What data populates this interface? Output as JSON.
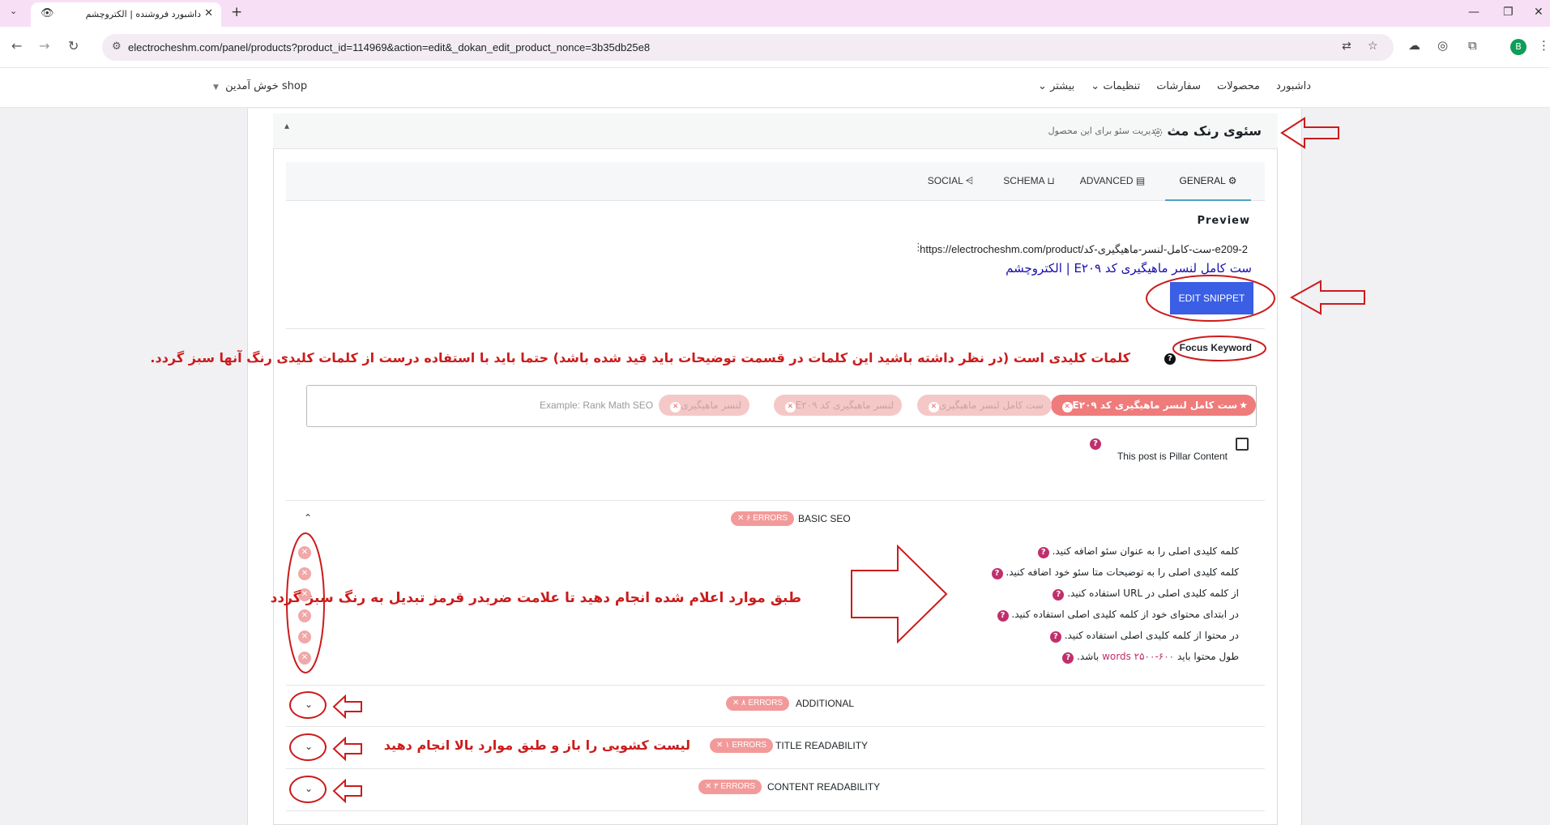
{
  "browser": {
    "tab_title": "داشبورد فروشنده | الکتروچشم",
    "url": "electrocheshm.com/panel/products?product_id=114969&action=edit&_dokan_edit_product_nonce=3b35db25e8",
    "profile_initial": "B"
  },
  "header": {
    "shop_menu": "shop خوش آمدین",
    "nav": [
      "داشبورد",
      "محصولات",
      "سفارشات",
      "تنظیمات",
      "بیشتر"
    ]
  },
  "panel": {
    "title": "سئوی رنک مث",
    "subtitle": "مدیریت سئو برای این محصول"
  },
  "tabs": [
    "GENERAL",
    "ADVANCED",
    "SCHEMA",
    "SOCIAL"
  ],
  "preview": {
    "label": "Preview",
    "url": "https://electrocheshm.com/product/ست-کامل-لنسر-ماهیگیری-کد-e209-2",
    "title": "ست کامل لنسر ماهیگیری کد E۲۰۹ | الکتروچشم",
    "edit_button": "EDIT SNIPPET"
  },
  "focus": {
    "label": "Focus Keyword",
    "note": "کلمات کلیدی است (در نظر داشته باشید این کلمات در قسمت توضیحات باید قید شده باشد) حتما باید با استفاده درست از کلمات کلیدی رنگ آنها سبز گردد.",
    "keywords": [
      "ست کامل لنسر ماهیگیری کد E۲۰۹",
      "ست کامل لنسر ماهیگیری",
      "لنسر ماهیگیری کد E۲۰۹",
      "لنسر ماهیگیری"
    ],
    "placeholder": "Example: Rank Math SEO",
    "pillar_label": "This post is Pillar Content"
  },
  "basic_seo": {
    "title": "BASIC SEO",
    "errors": "۶ ERRORS",
    "note": "طبق موارد اعلام شده انجام دهید تا علامت ضربدر قرمز تبدیل به رنگ سبز گردد",
    "items": [
      "کلمه کلیدی اصلی را به عنوان سئو اضافه کنید.",
      "کلمه کلیدی اصلی را به توضیحات متا سئو خود اضافه کنید.",
      "از کلمه کلیدی اصلی در URL استفاده کنید.",
      "در ابتدای محتوای خود از کلمه کلیدی اصلی استفاده کنید.",
      "در محتوا از کلمه کلیدی اصلی استفاده کنید."
    ],
    "last_item_prefix": "طول محتوا باید",
    "last_item_link": "words ۲۵۰۰-۶۰۰",
    "last_item_suffix": "باشد."
  },
  "additional": {
    "title": "ADDITIONAL",
    "errors": "۸ ERRORS"
  },
  "title_readability": {
    "title": "TITLE READABILITY",
    "errors": "۱ ERRORS",
    "note": "لیست کشویی را  باز و طبق موارد بالا انجام دهید"
  },
  "content_readability": {
    "title": "CONTENT READABILITY",
    "errors": "۳ ERRORS"
  },
  "colors": {
    "accent_blue": "#3a5ee4",
    "error_pink": "#f29a9a",
    "annotation_red": "#cc1b1b",
    "tab_bar": "#f7e0f5"
  }
}
